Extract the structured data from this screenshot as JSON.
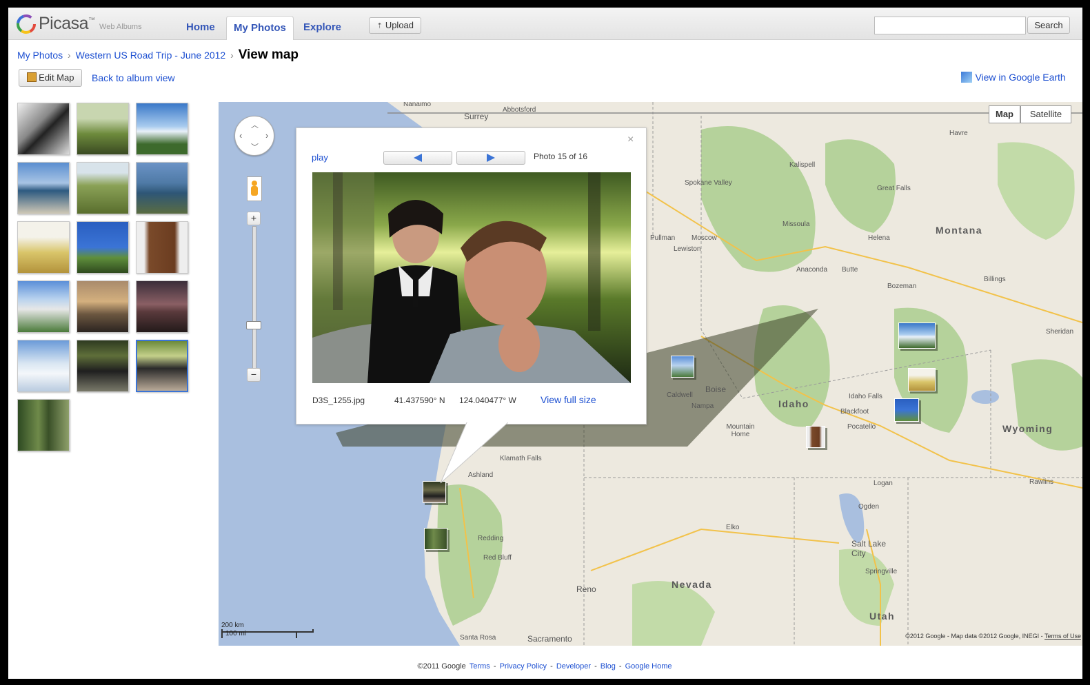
{
  "header": {
    "logo_text": "Picasa",
    "logo_tm": "™",
    "logo_sub": "Web Albums",
    "tabs": [
      {
        "label": "Home"
      },
      {
        "label": "My Photos"
      },
      {
        "label": "Explore"
      }
    ],
    "upload_label": "Upload",
    "search_placeholder": "",
    "search_label": "Search"
  },
  "breadcrumb": {
    "root": "My Photos",
    "album": "Western US Road Trip - June 2012",
    "current": "View map",
    "sep": "›"
  },
  "actions": {
    "edit_map": "Edit Map",
    "back": "Back to album view",
    "google_earth": "View in Google Earth"
  },
  "map": {
    "map_button": "Map",
    "satellite_button": "Satellite",
    "scale_km": "200 km",
    "scale_mi": "100 mi",
    "copyright": "©2012 Google - Map data ©2012 Google, INEGI -",
    "terms": "Terms of Use",
    "states": [
      "Montana",
      "Idaho",
      "Wyoming",
      "Nevada",
      "Utah"
    ],
    "cities": [
      "Nanaimo",
      "Surrey",
      "Abbotsford",
      "Kalispell",
      "Spokane Valley",
      "Great Falls",
      "Havre",
      "Missoula",
      "Helena",
      "Pullman",
      "Moscow",
      "Lewiston",
      "Anaconda",
      "Butte",
      "Bozeman",
      "Billings",
      "Sheridan",
      "Caldwell",
      "Boise",
      "Nampa",
      "Idaho Falls",
      "Blackfoot",
      "Pocatello",
      "Mountain Home",
      "Klamath Falls",
      "Ashland",
      "Redding",
      "Red Bluff",
      "Logan",
      "Ogden",
      "Salt Lake City",
      "Springville",
      "Elko",
      "Rawlins",
      "Reno",
      "Santa Rosa",
      "Sacramento"
    ]
  },
  "popup": {
    "play": "play",
    "prev_icon": "left-arrow-icon",
    "next_icon": "right-arrow-icon",
    "counter": "Photo 15 of 16",
    "filename": "D3S_1255.jpg",
    "lat": "41.437590° N",
    "lon": "124.040477° W",
    "view_full": "View full size",
    "close": "×"
  },
  "footer": {
    "copyright": "©2011 Google",
    "links": [
      "Terms",
      "Privacy Policy",
      "Developer",
      "Blog",
      "Google Home"
    ],
    "sep": "-"
  },
  "colors": {
    "link": "#1c4fd1",
    "land": "#ede9df",
    "forest": "#b5d29b",
    "water": "#a9bfdf",
    "selected_border": "#3b74d6"
  }
}
